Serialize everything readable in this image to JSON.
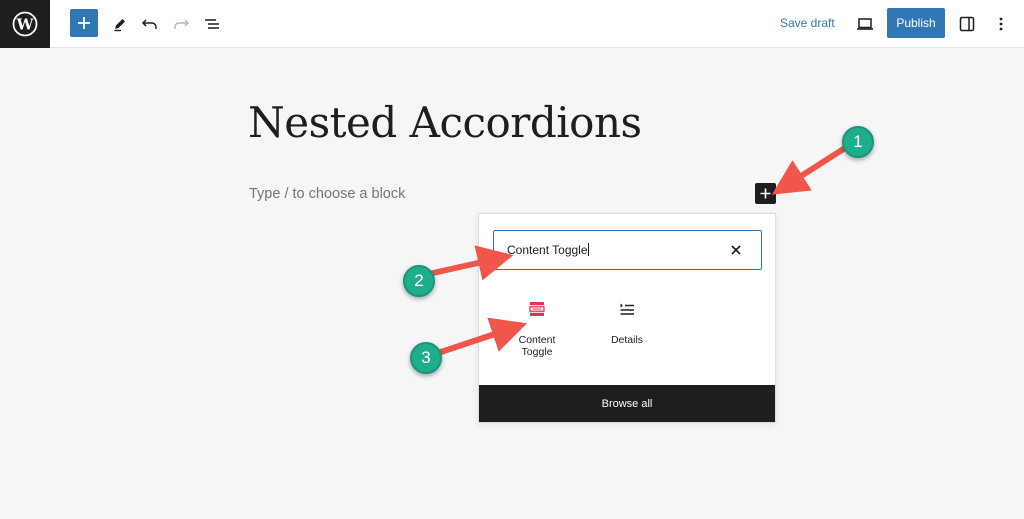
{
  "toolbar": {
    "save_draft_label": "Save draft",
    "publish_label": "Publish"
  },
  "editor": {
    "post_title": "Nested Accordions",
    "block_placeholder": "Type / to choose a block"
  },
  "inserter": {
    "search_value": "Content Toggle",
    "blocks": [
      {
        "label": "Content Toggle",
        "icon": "content-toggle-icon"
      },
      {
        "label": "Details",
        "icon": "details-list-icon"
      }
    ],
    "browse_all_label": "Browse all"
  },
  "annotations": {
    "markers": [
      "1",
      "2",
      "3"
    ],
    "marker_color": "#1fae8c",
    "arrow_color": "#f0574a"
  },
  "colors": {
    "accent": "#3177b6",
    "dark": "#1e1e1e",
    "block_icon": "#d43a54"
  }
}
